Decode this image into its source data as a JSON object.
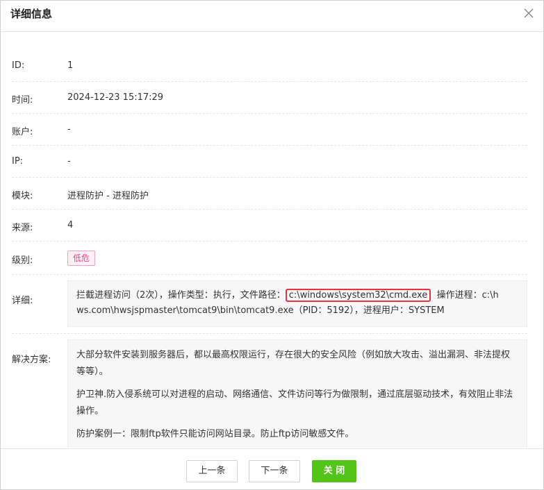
{
  "dialog": {
    "title": "详细信息",
    "close_icon": "close-icon"
  },
  "fields": {
    "id": {
      "label": "ID:",
      "value": "1"
    },
    "time": {
      "label": "时间:",
      "value": "2024-12-23 15:17:29"
    },
    "account": {
      "label": "账户:",
      "value": "-"
    },
    "ip": {
      "label": "IP:",
      "value": "-"
    },
    "module": {
      "label": "模块:",
      "value": "进程防护 - 进程防护"
    },
    "source": {
      "label": "来源:",
      "value": "4"
    },
    "level": {
      "label": "级别:",
      "value": "低危",
      "badge_color": "#e0458a"
    },
    "detail": {
      "label": "详细:",
      "prefix": "拦截进程访问（2次），操作类型：执行，文件路径：",
      "highlight": "c:\\windows\\system32\\cmd.exe",
      "suffix_line1": "  操作进程：c:\\h",
      "line2": "ws.com\\hwsjspmaster\\tomcat9\\bin\\tomcat9.exe（PID：5192），进程用户：SYSTEM"
    },
    "solution": {
      "label": "解决方案:",
      "p1": "大部分软件安装到服务器后，都以最高权限运行，存在很大的安全风险（例如放大攻击、溢出漏洞、非法提权等等）。",
      "p2": "护卫神.防入侵系统可以对进程的启动、网络通信、文件访问等行为做限制，通过底层驱动技术，有效阻止非法操作。",
      "p3": "防护案例一：限制ftp软件只能访问网站目录。防止ftp访问敏感文件。"
    }
  },
  "footer": {
    "prev_label": "上一条",
    "next_label": "下一条",
    "close_label": "关 闭",
    "close_color": "#52c41a"
  }
}
